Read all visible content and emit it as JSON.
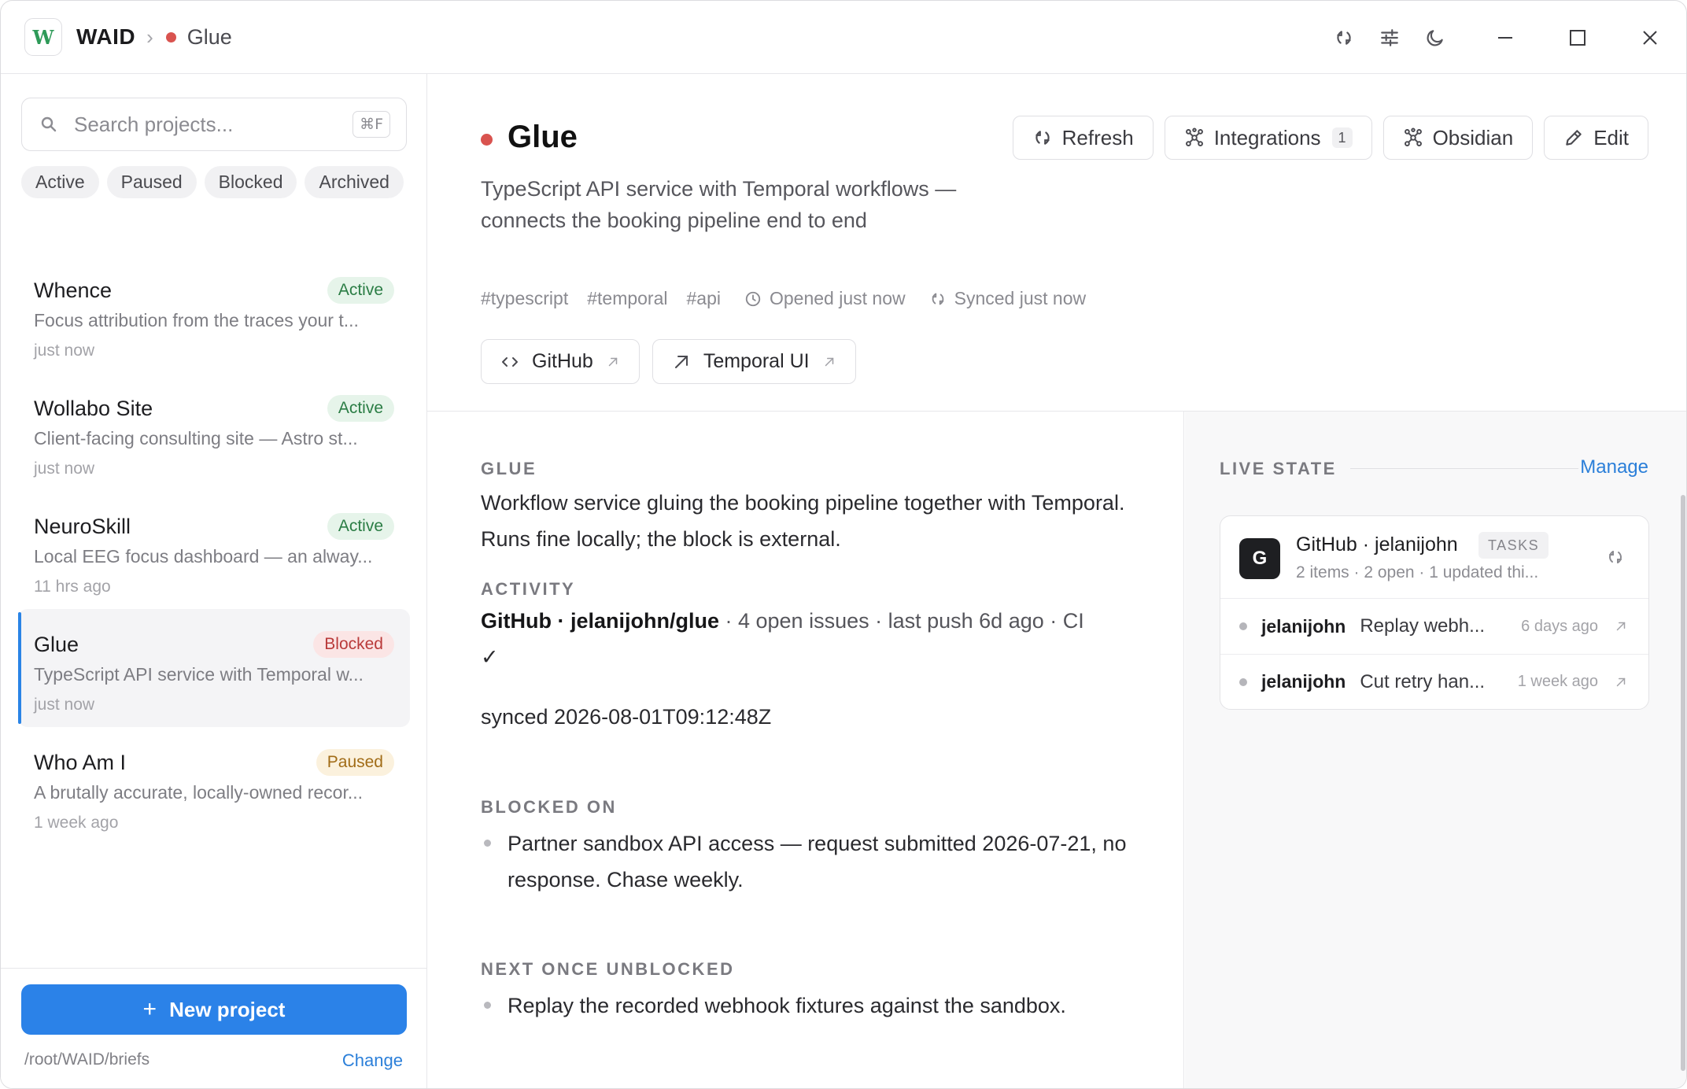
{
  "titlebar": {
    "logo": "W",
    "app": "WAID",
    "separator": "›",
    "current": "Glue",
    "icons": [
      "sync-icon",
      "sliders-icon",
      "moon-icon"
    ],
    "controls": [
      "minimize-icon",
      "maximize-icon",
      "close-icon"
    ]
  },
  "sidebar": {
    "search": {
      "placeholder": "Search projects...",
      "value": "",
      "shortcut": "⌘F"
    },
    "filters": [
      "Active",
      "Paused",
      "Blocked",
      "Archived"
    ],
    "projects": [
      {
        "name": "Whence",
        "status": "Active",
        "desc": "Focus attribution from the traces your t...",
        "time": "just now"
      },
      {
        "name": "Wollabo Site",
        "status": "Active",
        "desc": "Client-facing consulting site — Astro st...",
        "time": "just now"
      },
      {
        "name": "NeuroSkill",
        "status": "Active",
        "desc": "Local EEG focus dashboard — an alway...",
        "time": "11 hrs ago"
      },
      {
        "name": "Glue",
        "status": "Blocked",
        "desc": "TypeScript API service with Temporal w...",
        "time": "just now",
        "selected": true
      },
      {
        "name": "Who Am I",
        "status": "Paused",
        "desc": "A brutally accurate, locally-owned recor...",
        "time": "1 week ago"
      }
    ],
    "new_project": "New project",
    "new_project_icon": "+",
    "path": "/root/WAID/briefs",
    "change": "Change"
  },
  "header": {
    "title": "Glue",
    "status_color": "#d9534f",
    "description": "TypeScript API service with Temporal workflows — connects the booking pipeline end to end",
    "tags": [
      "#typescript",
      "#temporal",
      "#api"
    ],
    "opened": "Opened just now",
    "synced": "Synced just now",
    "links": [
      {
        "label": "GitHub",
        "icon": "code-icon"
      },
      {
        "label": "Temporal UI",
        "icon": "arrow-up-right-icon"
      }
    ],
    "actions": {
      "refresh": "Refresh",
      "integrations": "Integrations",
      "integrations_count": "1",
      "obsidian": "Obsidian",
      "edit": "Edit"
    }
  },
  "content": {
    "section_title": "GLUE",
    "summary": "Workflow service gluing the booking pipeline together with Temporal. Runs fine locally; the block is external.",
    "activity_title": "ACTIVITY",
    "activity_source": "GitHub · jelanijohn/glue",
    "activity_detail": " · 4 open issues · last push 6d ago · CI",
    "activity_check": "✓",
    "activity_synced": "synced 2026-08-01T09:12:48Z",
    "blocked_title": "BLOCKED ON",
    "blocked_items": [
      "Partner sandbox API access — request submitted 2026-07-21, no response. Chase weekly."
    ],
    "next_title": "NEXT ONCE UNBLOCKED",
    "next_items": [
      "Replay the recorded webhook fixtures against the sandbox."
    ]
  },
  "live_state": {
    "title": "LIVE STATE",
    "manage": "Manage",
    "card": {
      "avatar": "G",
      "title": "GitHub · jelanijohn",
      "badge": "TASKS",
      "subtitle": "2 items · 2 open · 1 updated thi...",
      "items": [
        {
          "who": "jelanijohn",
          "what": "Replay webh...",
          "when": "6 days ago"
        },
        {
          "who": "jelanijohn",
          "what": "Cut retry han...",
          "when": "1 week ago"
        }
      ]
    }
  },
  "colors": {
    "accent": "#2b82e8",
    "blocked": "#d9534f",
    "active_badge": "#2b7d45",
    "paused_badge": "#a16c17"
  }
}
